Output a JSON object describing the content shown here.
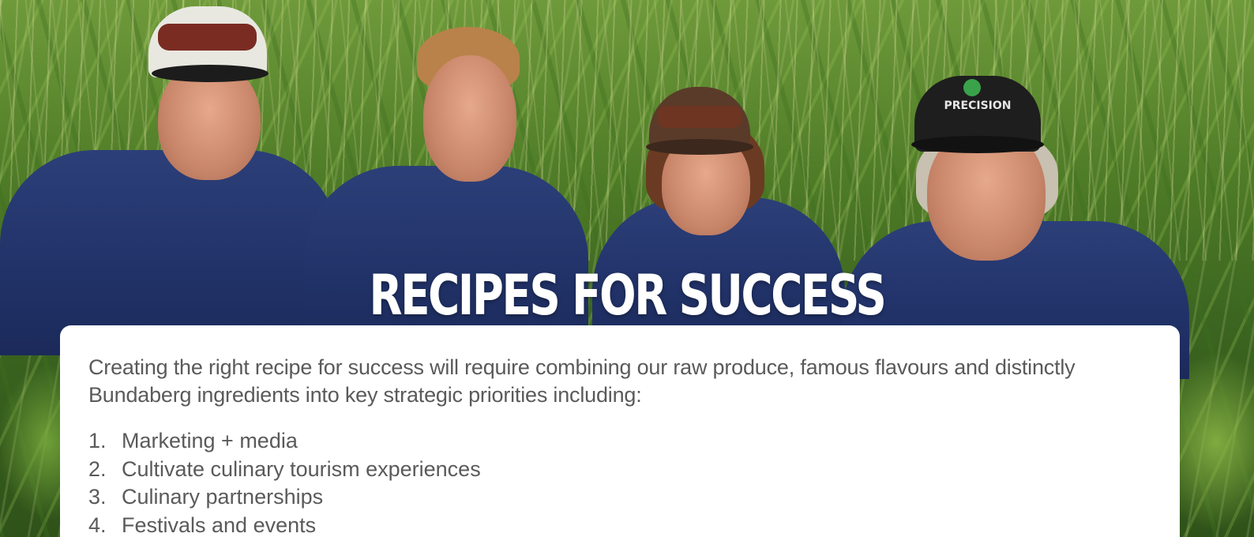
{
  "hero": {
    "title": "RECIPES FOR SUCCESS",
    "background_description_icon": "corn-field-photo",
    "cap_text": "PRECISION"
  },
  "card": {
    "intro": "Creating the right recipe for success will require combining our raw produce, famous flavours and distinctly Bundaberg ingredients into key strategic priorities including:",
    "priorities": [
      {
        "number": "1.",
        "label": "Marketing + media"
      },
      {
        "number": "2.",
        "label": "Cultivate culinary tourism experiences"
      },
      {
        "number": "3.",
        "label": "Culinary partnerships"
      },
      {
        "number": "4.",
        "label": "Festivals and events"
      }
    ]
  },
  "colors": {
    "card_bg": "#ffffff",
    "text": "#5a5a5a",
    "shirt": "#22336a",
    "title": "#ffffff"
  }
}
